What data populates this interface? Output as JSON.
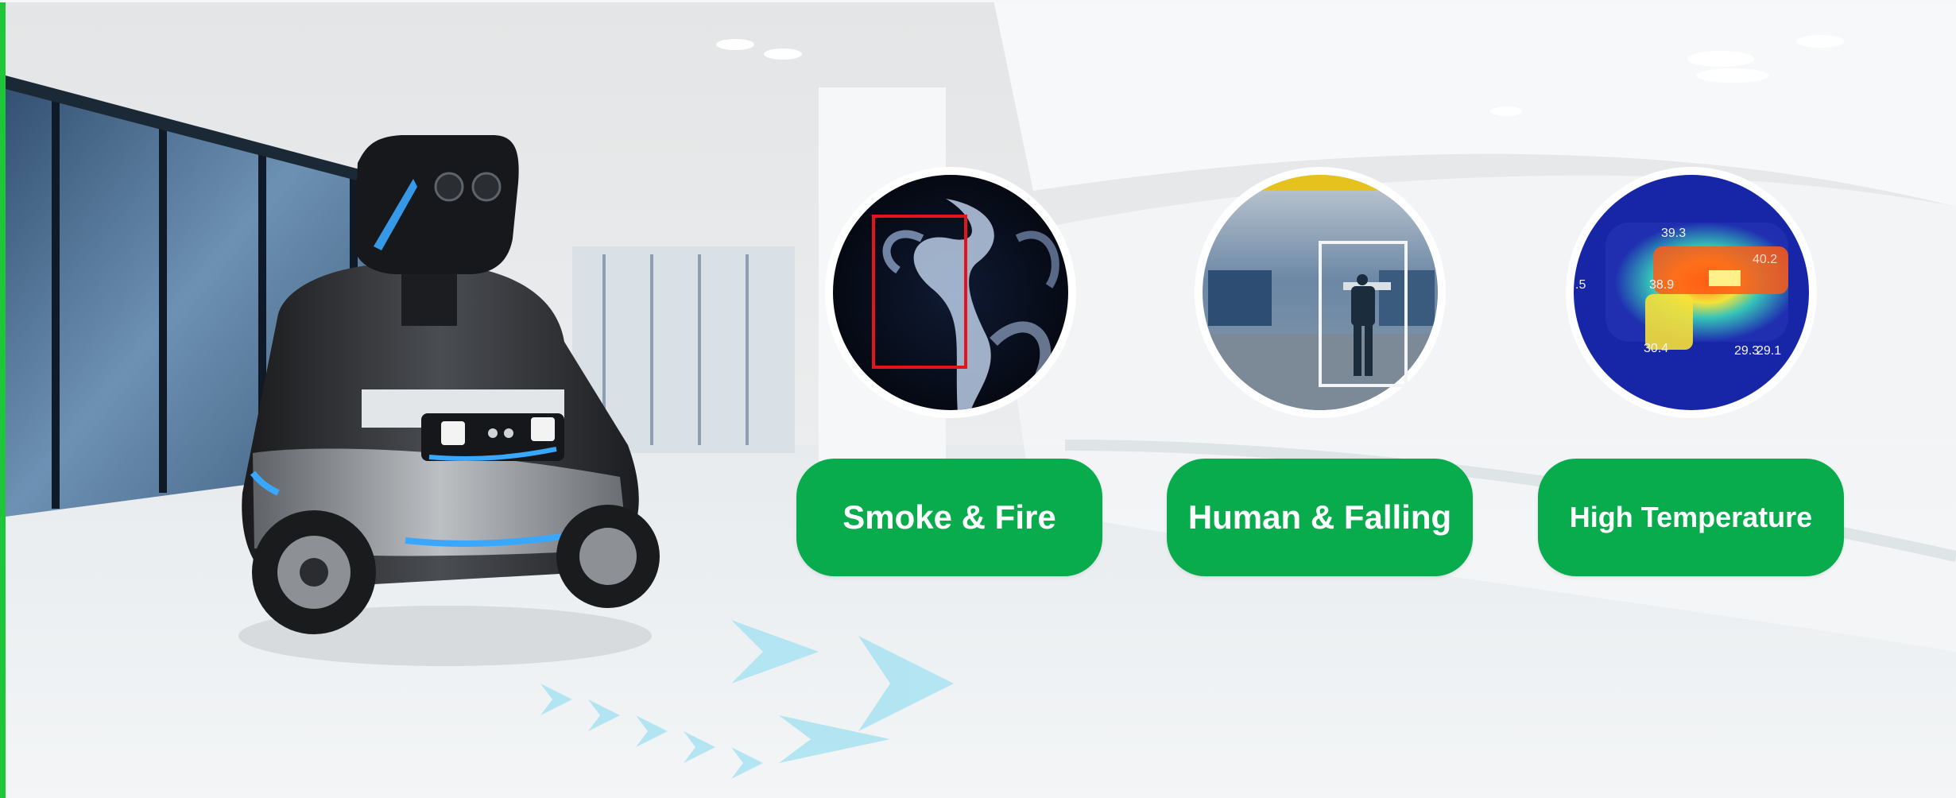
{
  "features": [
    {
      "label": "Smoke & Fire"
    },
    {
      "label": "Human & Falling"
    },
    {
      "label": "High Temperature"
    }
  ],
  "thermal_readings": [
    "39.3",
    "38.9",
    "30.4",
    "29.3",
    "29.1",
    ".5",
    "40.2"
  ],
  "colors": {
    "pill_green": "#09ac4d",
    "detection_box": "#e1141f",
    "robot_light": "#2fa0ff",
    "left_edge": "#1fc63a"
  }
}
